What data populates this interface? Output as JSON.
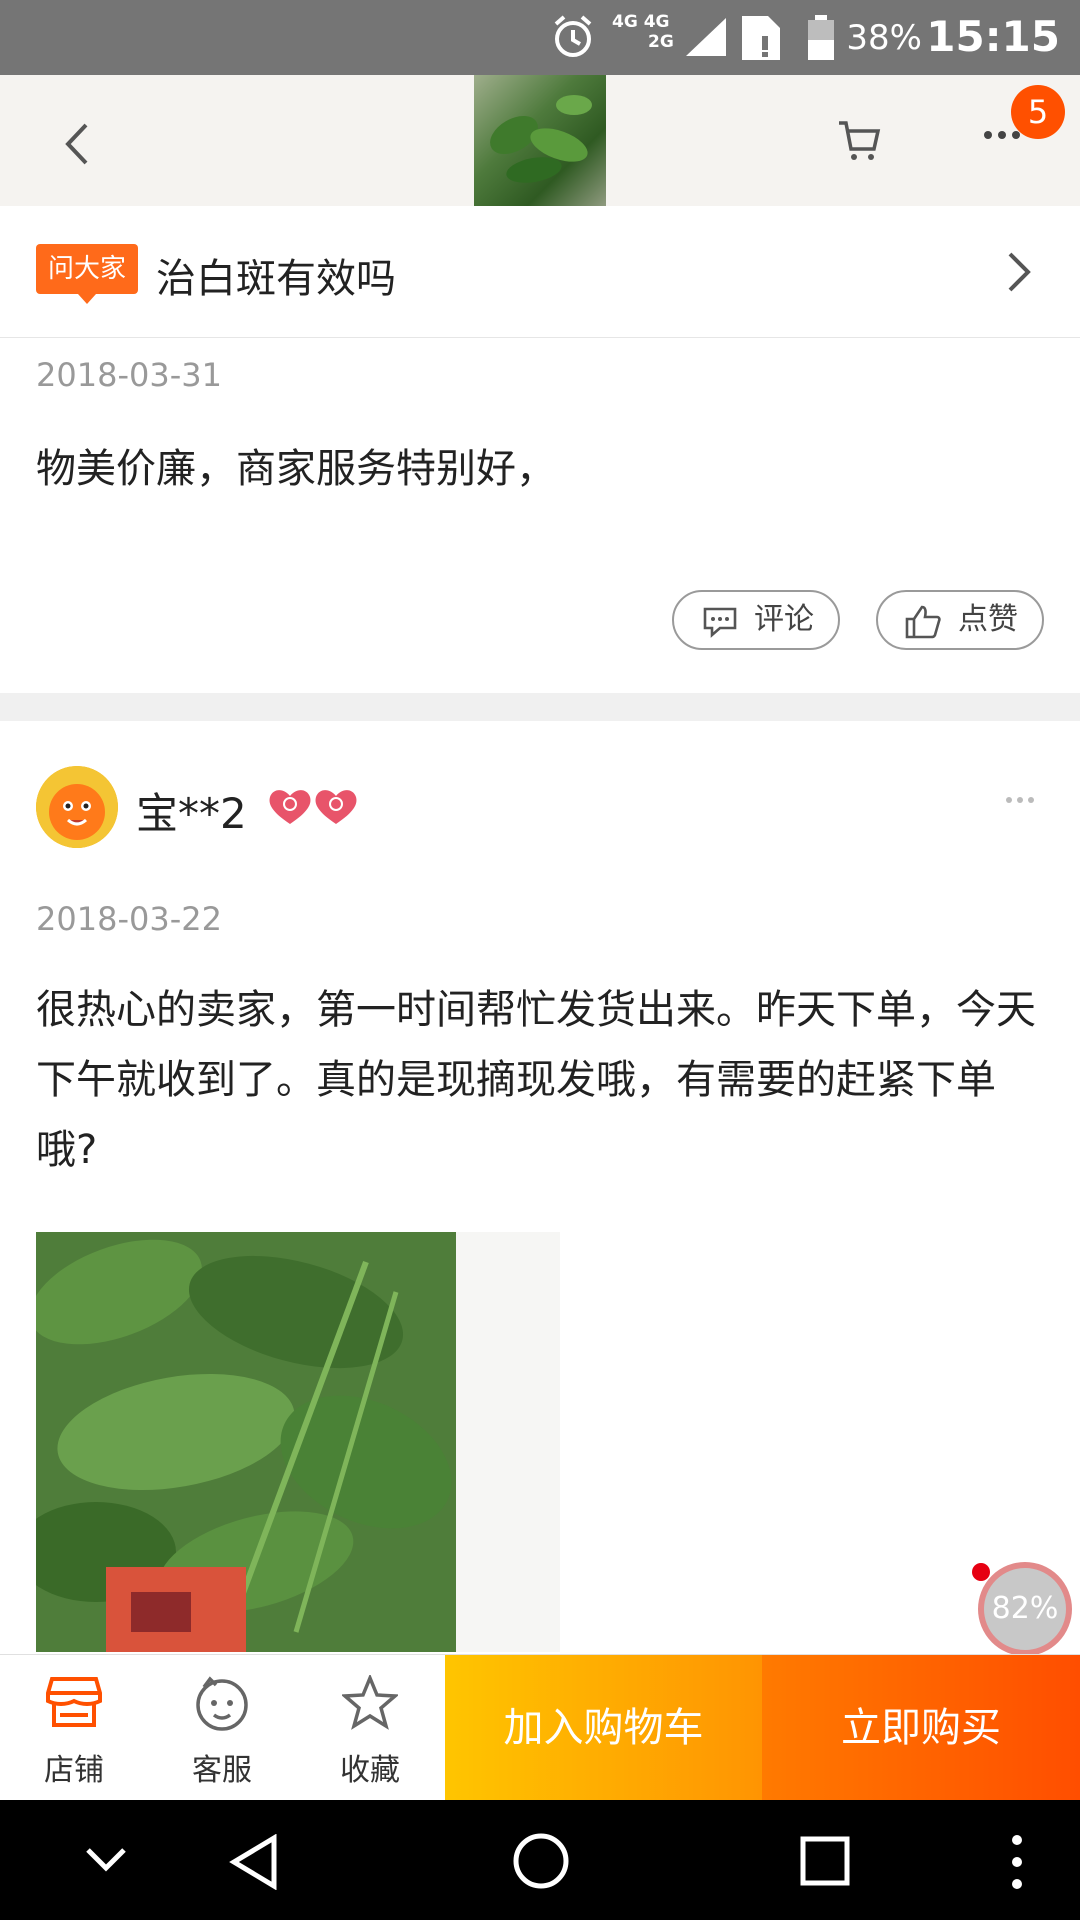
{
  "status_bar": {
    "network_top": "4G 4G",
    "network_bottom": "2G",
    "battery": "38%",
    "time": "15:15"
  },
  "header": {
    "cart_badge_count": "5"
  },
  "question": {
    "tag": "问大家",
    "text": "治白斑有效吗"
  },
  "review1": {
    "date": "2018-03-31",
    "text": "物美价廉，商家服务特别好，",
    "comment_label": "评论",
    "like_label": "点赞"
  },
  "review2": {
    "username": "宝**2",
    "date": "2018-03-22",
    "text": "很热心的卖家，第一时间帮忙发货出来。昨天下单，今天下午就收到了。真的是现摘现发哦，有需要的赶紧下单哦?"
  },
  "progress": "82%",
  "action_bar": {
    "shop_label": "店铺",
    "service_label": "客服",
    "favorite_label": "收藏",
    "add_cart_label": "加入购物车",
    "buy_now_label": "立即购买"
  },
  "colors": {
    "accent": "#ff5000",
    "cart_button_start": "#ffc500",
    "buy_button_end": "#ff4e00"
  }
}
